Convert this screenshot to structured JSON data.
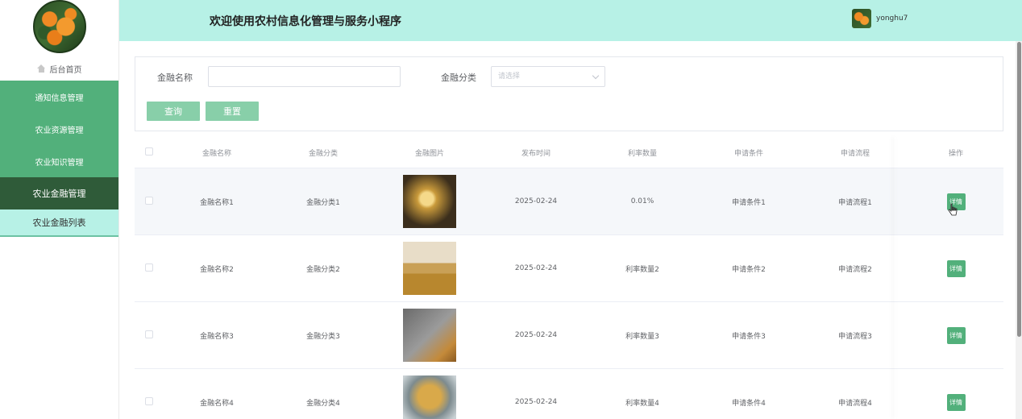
{
  "header": {
    "title": "欢迎使用农村信息化管理与服务小程序",
    "username": "yonghu7"
  },
  "sidebar": {
    "home_label": "后台首页",
    "items": [
      {
        "label": "通知信息管理"
      },
      {
        "label": "农业资源管理"
      },
      {
        "label": "农业知识管理"
      },
      {
        "label": "农业金融管理"
      }
    ],
    "subitem_label": "农业金融列表"
  },
  "search": {
    "name_label": "金融名称",
    "name_value": "",
    "category_label": "金融分类",
    "category_placeholder": "请选择",
    "query_label": "查询",
    "reset_label": "重置"
  },
  "table": {
    "headers": [
      "金融名称",
      "金融分类",
      "金融图片",
      "发布时间",
      "利率数量",
      "申请条件",
      "申请流程",
      "操作"
    ],
    "rows": [
      {
        "name": "金融名称1",
        "category": "金融分类1",
        "time": "2025-02-24",
        "rate": "0.01%",
        "condition": "申请条件1",
        "process": "申请流程1",
        "action": "详情"
      },
      {
        "name": "金融名称2",
        "category": "金融分类2",
        "time": "2025-02-24",
        "rate": "利率数量2",
        "condition": "申请条件2",
        "process": "申请流程2",
        "action": "详情"
      },
      {
        "name": "金融名称3",
        "category": "金融分类3",
        "time": "2025-02-24",
        "rate": "利率数量3",
        "condition": "申请条件3",
        "process": "申请流程3",
        "action": "详情"
      },
      {
        "name": "金融名称4",
        "category": "金融分类4",
        "time": "2025-02-24",
        "rate": "利率数量4",
        "condition": "申请条件4",
        "process": "申请流程4",
        "action": "详情"
      }
    ]
  },
  "colors": {
    "accent": "#52b07b",
    "header_bg": "#b7f1e6",
    "active_menu": "#2f5b39"
  }
}
